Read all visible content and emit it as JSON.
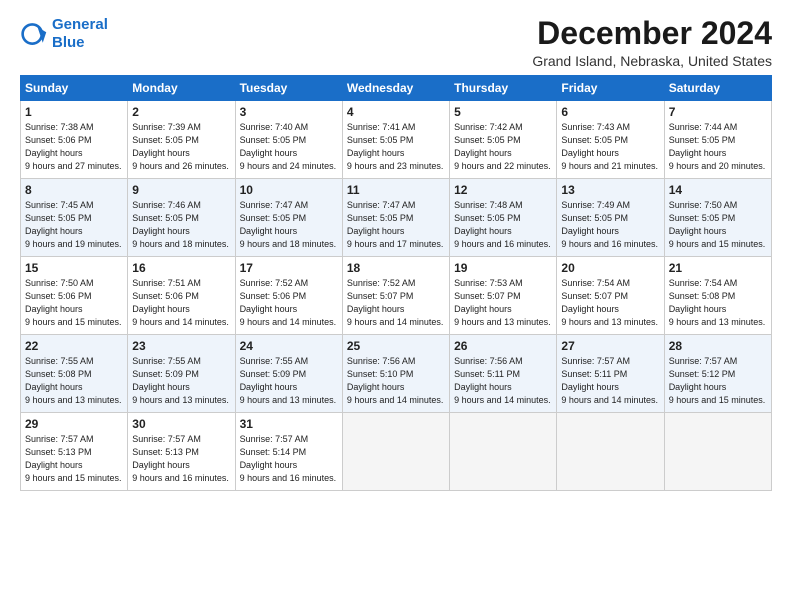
{
  "header": {
    "logo_line1": "General",
    "logo_line2": "Blue",
    "title": "December 2024",
    "location": "Grand Island, Nebraska, United States"
  },
  "weekdays": [
    "Sunday",
    "Monday",
    "Tuesday",
    "Wednesday",
    "Thursday",
    "Friday",
    "Saturday"
  ],
  "weeks": [
    [
      {
        "day": "1",
        "sunrise": "7:38 AM",
        "sunset": "5:06 PM",
        "daylight": "9 hours and 27 minutes."
      },
      {
        "day": "2",
        "sunrise": "7:39 AM",
        "sunset": "5:05 PM",
        "daylight": "9 hours and 26 minutes."
      },
      {
        "day": "3",
        "sunrise": "7:40 AM",
        "sunset": "5:05 PM",
        "daylight": "9 hours and 24 minutes."
      },
      {
        "day": "4",
        "sunrise": "7:41 AM",
        "sunset": "5:05 PM",
        "daylight": "9 hours and 23 minutes."
      },
      {
        "day": "5",
        "sunrise": "7:42 AM",
        "sunset": "5:05 PM",
        "daylight": "9 hours and 22 minutes."
      },
      {
        "day": "6",
        "sunrise": "7:43 AM",
        "sunset": "5:05 PM",
        "daylight": "9 hours and 21 minutes."
      },
      {
        "day": "7",
        "sunrise": "7:44 AM",
        "sunset": "5:05 PM",
        "daylight": "9 hours and 20 minutes."
      }
    ],
    [
      {
        "day": "8",
        "sunrise": "7:45 AM",
        "sunset": "5:05 PM",
        "daylight": "9 hours and 19 minutes."
      },
      {
        "day": "9",
        "sunrise": "7:46 AM",
        "sunset": "5:05 PM",
        "daylight": "9 hours and 18 minutes."
      },
      {
        "day": "10",
        "sunrise": "7:47 AM",
        "sunset": "5:05 PM",
        "daylight": "9 hours and 18 minutes."
      },
      {
        "day": "11",
        "sunrise": "7:47 AM",
        "sunset": "5:05 PM",
        "daylight": "9 hours and 17 minutes."
      },
      {
        "day": "12",
        "sunrise": "7:48 AM",
        "sunset": "5:05 PM",
        "daylight": "9 hours and 16 minutes."
      },
      {
        "day": "13",
        "sunrise": "7:49 AM",
        "sunset": "5:05 PM",
        "daylight": "9 hours and 16 minutes."
      },
      {
        "day": "14",
        "sunrise": "7:50 AM",
        "sunset": "5:05 PM",
        "daylight": "9 hours and 15 minutes."
      }
    ],
    [
      {
        "day": "15",
        "sunrise": "7:50 AM",
        "sunset": "5:06 PM",
        "daylight": "9 hours and 15 minutes."
      },
      {
        "day": "16",
        "sunrise": "7:51 AM",
        "sunset": "5:06 PM",
        "daylight": "9 hours and 14 minutes."
      },
      {
        "day": "17",
        "sunrise": "7:52 AM",
        "sunset": "5:06 PM",
        "daylight": "9 hours and 14 minutes."
      },
      {
        "day": "18",
        "sunrise": "7:52 AM",
        "sunset": "5:07 PM",
        "daylight": "9 hours and 14 minutes."
      },
      {
        "day": "19",
        "sunrise": "7:53 AM",
        "sunset": "5:07 PM",
        "daylight": "9 hours and 13 minutes."
      },
      {
        "day": "20",
        "sunrise": "7:54 AM",
        "sunset": "5:07 PM",
        "daylight": "9 hours and 13 minutes."
      },
      {
        "day": "21",
        "sunrise": "7:54 AM",
        "sunset": "5:08 PM",
        "daylight": "9 hours and 13 minutes."
      }
    ],
    [
      {
        "day": "22",
        "sunrise": "7:55 AM",
        "sunset": "5:08 PM",
        "daylight": "9 hours and 13 minutes."
      },
      {
        "day": "23",
        "sunrise": "7:55 AM",
        "sunset": "5:09 PM",
        "daylight": "9 hours and 13 minutes."
      },
      {
        "day": "24",
        "sunrise": "7:55 AM",
        "sunset": "5:09 PM",
        "daylight": "9 hours and 13 minutes."
      },
      {
        "day": "25",
        "sunrise": "7:56 AM",
        "sunset": "5:10 PM",
        "daylight": "9 hours and 14 minutes."
      },
      {
        "day": "26",
        "sunrise": "7:56 AM",
        "sunset": "5:11 PM",
        "daylight": "9 hours and 14 minutes."
      },
      {
        "day": "27",
        "sunrise": "7:57 AM",
        "sunset": "5:11 PM",
        "daylight": "9 hours and 14 minutes."
      },
      {
        "day": "28",
        "sunrise": "7:57 AM",
        "sunset": "5:12 PM",
        "daylight": "9 hours and 15 minutes."
      }
    ],
    [
      {
        "day": "29",
        "sunrise": "7:57 AM",
        "sunset": "5:13 PM",
        "daylight": "9 hours and 15 minutes."
      },
      {
        "day": "30",
        "sunrise": "7:57 AM",
        "sunset": "5:13 PM",
        "daylight": "9 hours and 16 minutes."
      },
      {
        "day": "31",
        "sunrise": "7:57 AM",
        "sunset": "5:14 PM",
        "daylight": "9 hours and 16 minutes."
      },
      null,
      null,
      null,
      null
    ]
  ]
}
